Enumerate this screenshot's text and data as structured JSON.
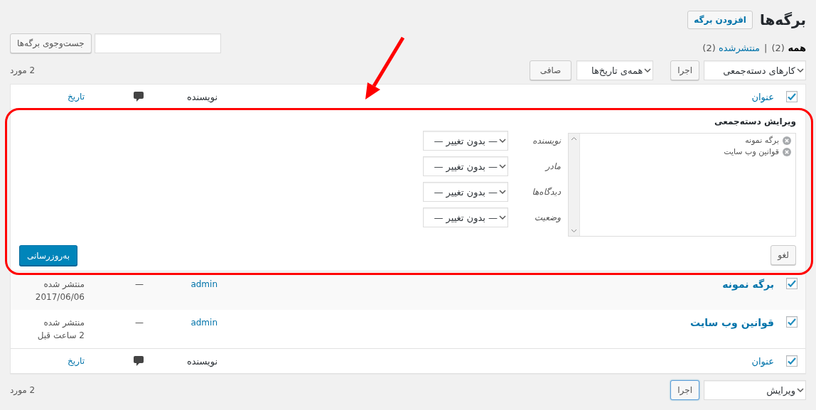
{
  "page": {
    "title": "برگه‌ها",
    "add_button": "افزودن برگه"
  },
  "views": [
    {
      "label": "همه",
      "count": "(2)",
      "selected": true
    },
    {
      "label": "منتشرشده",
      "count": "(2)",
      "selected": false
    }
  ],
  "view_separator": "|",
  "search": {
    "button": "جست‌وجوی برگه‌ها"
  },
  "top_nav": {
    "bulk_action": "کارهای دسته‌جمعی",
    "apply": "اجرا",
    "apply_focused": false,
    "date_filter": "همه‌ی تاریخ‌ها",
    "filter": "صافی",
    "count": "2 مورد"
  },
  "table": {
    "header": {
      "checked": true,
      "title": "عنوان",
      "author": "نویسنده",
      "date": "تاریخ"
    },
    "bulk_edit": {
      "title": "ویرایش دسته‌جمعی",
      "items": [
        "برگه نمونه",
        "قوانین وب سایت"
      ],
      "fields": [
        {
          "label": "نویسنده",
          "value": "— بدون تغییر —"
        },
        {
          "label": "مادر",
          "value": "— بدون تغییر —"
        },
        {
          "label": "دیدگاه‌ها",
          "value": "— بدون تغییر —"
        },
        {
          "label": "وضعیت",
          "value": "— بدون تغییر —"
        }
      ],
      "cancel": "لغو",
      "update": "به‌روزرسانی"
    },
    "rows": [
      {
        "checked": true,
        "title": "برگه نمونه",
        "author": "admin",
        "comments": "—",
        "status": "منتشر شده",
        "date": "2017/06/06"
      },
      {
        "checked": true,
        "title": "قوانین وب سایت",
        "author": "admin",
        "comments": "—",
        "status": "منتشر شده",
        "date": "2 ساعت قبل"
      }
    ],
    "footer": {
      "checked": true,
      "title": "عنوان",
      "author": "نویسنده",
      "date": "تاریخ"
    }
  },
  "bottom_nav": {
    "bulk_action": "ویرایش",
    "apply": "اجرا",
    "apply_focused": true,
    "count": "2 مورد"
  }
}
